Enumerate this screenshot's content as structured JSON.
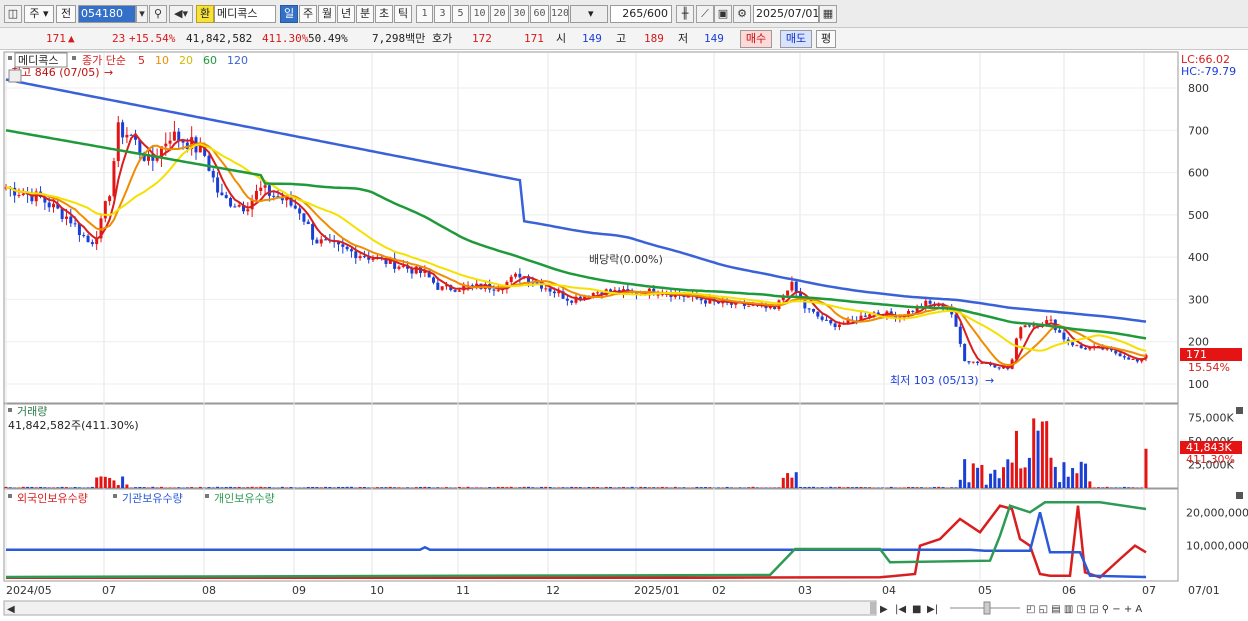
{
  "toolbar": {
    "market": "주",
    "prev": "전",
    "code": "054180",
    "hwan": "환",
    "name": "메디콕스",
    "periods": [
      "일",
      "주",
      "월",
      "년",
      "분",
      "초",
      "틱"
    ],
    "active_period": "일",
    "intervals": [
      "1",
      "3",
      "5",
      "10",
      "20",
      "30",
      "60",
      "120"
    ],
    "count": "265",
    "count_max": "/600",
    "date": "2025/07/01"
  },
  "infobar": {
    "price": "171",
    "change_arrow": "▲",
    "change": "23",
    "change_pct": "+15.54%",
    "volume": "41,842,582",
    "vol_ratio": "411.30%",
    "turnover": "50.49%",
    "amount": "7,298백만",
    "bid_label": "호가",
    "ask_price": "172",
    "bid_price": "171",
    "open_label": "시",
    "open": "149",
    "high_label": "고",
    "high": "189",
    "low_label": "저",
    "low": "149",
    "buy_label": "매수",
    "sell_label": "매도",
    "avg_label": "평"
  },
  "price_panel": {
    "stock_label": "메디콕스",
    "indicator_label": "종가 단순",
    "ma_periods": [
      "5",
      "10",
      "20",
      "60",
      "120"
    ],
    "ma_colors": [
      "#d81e1e",
      "#f08c00",
      "#f5e000",
      "#1f9a3a",
      "#3a62d8"
    ],
    "high_note": "최고 846 (07/05)",
    "low_note": "최저 103 (05/13)",
    "dividend_note": "배당락(0.00%)",
    "lc": "LC:66.02",
    "hc": "HC:-79.79",
    "current_price": "171",
    "current_pct": "15.54%",
    "y_ticks": [
      "800",
      "700",
      "600",
      "500",
      "400",
      "300",
      "200",
      "100"
    ]
  },
  "volume_panel": {
    "title": "거래량",
    "value": "41,842,582주(411.30%)",
    "y_ticks": [
      "75,000K",
      "50,000K",
      "25,000K"
    ],
    "current_label": "41,843K",
    "current_pct": "411.30%"
  },
  "holdings_panel": {
    "series_names": [
      "외국인보유수량",
      "기관보유수량",
      "개인보유수량"
    ],
    "series_colors": [
      "#d81e1e",
      "#2a5ad8",
      "#2e9a55"
    ],
    "y_ticks": [
      "20,000,000",
      "10,000,000"
    ]
  },
  "x_axis": {
    "labels": [
      "2024/05",
      "07",
      "08",
      "09",
      "10",
      "11",
      "12",
      "2025/01",
      "02",
      "03",
      "04",
      "05",
      "06",
      "07"
    ],
    "right_label": "07/01"
  }
}
